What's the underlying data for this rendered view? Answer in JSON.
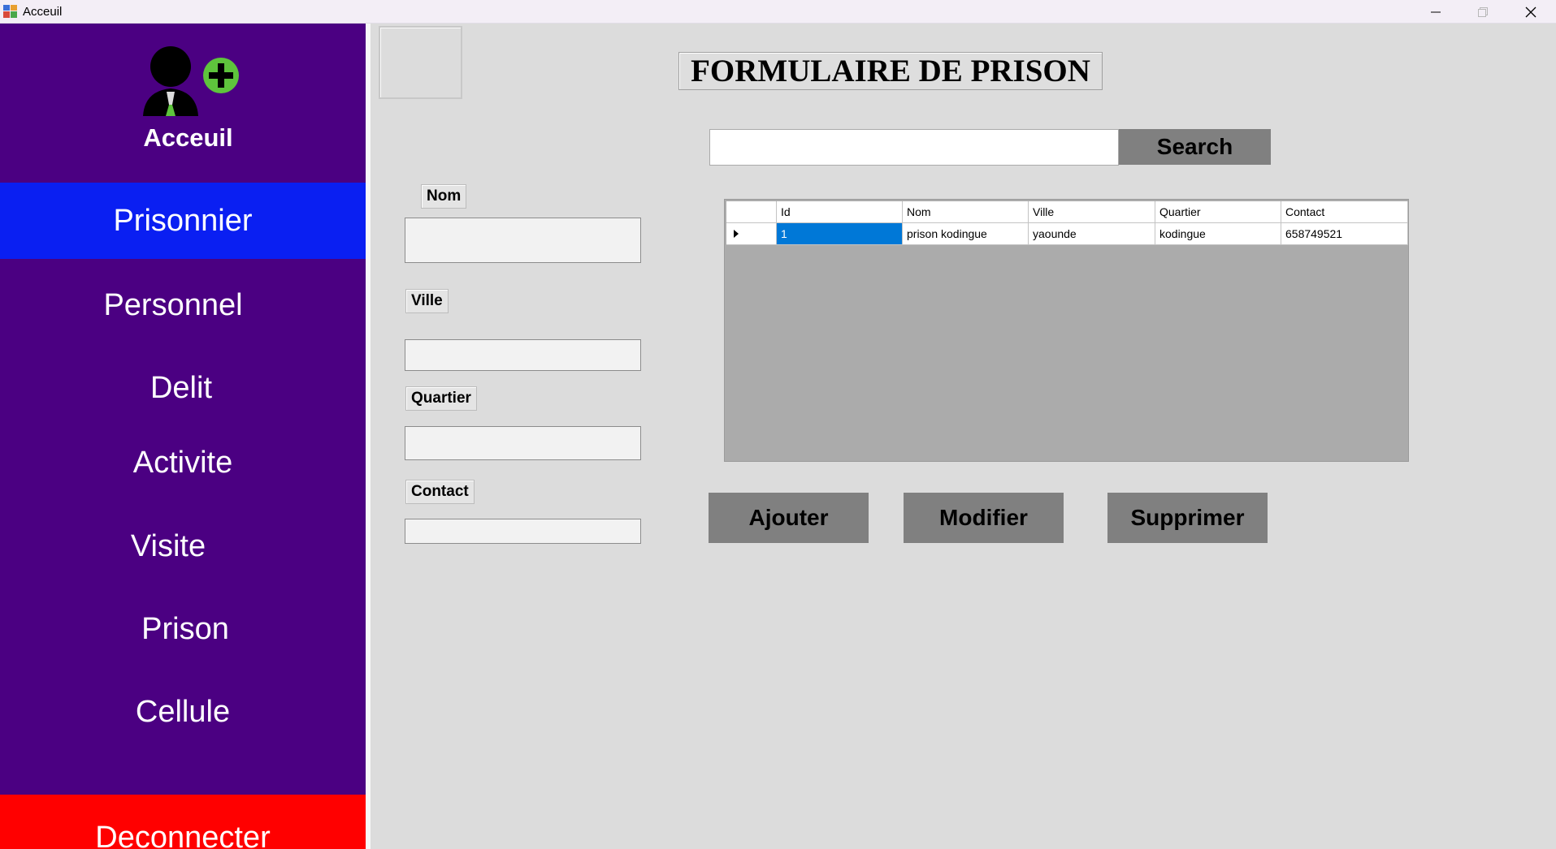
{
  "window": {
    "title": "Acceuil"
  },
  "sidebar": {
    "home_label": "Acceuil",
    "items": [
      {
        "label": "Prisonnier",
        "active": true
      },
      {
        "label": "Personnel",
        "active": false
      },
      {
        "label": "Delit",
        "active": false
      },
      {
        "label": "Activite",
        "active": false
      },
      {
        "label": "Visite",
        "active": false
      },
      {
        "label": "Prison",
        "active": false
      },
      {
        "label": "Cellule",
        "active": false
      }
    ],
    "logout_label": "Deconnecter",
    "colors": {
      "background": "#4b0082",
      "active": "#0a1ff2",
      "logout": "#ff0000"
    }
  },
  "main": {
    "title": "FORMULAIRE DE PRISON",
    "search": {
      "value": "",
      "button_label": "Search"
    },
    "form": {
      "nom_label": "Nom",
      "nom_value": "",
      "ville_label": "Ville",
      "ville_value": "",
      "quartier_label": "Quartier",
      "quartier_value": "",
      "contact_label": "Contact",
      "contact_value": ""
    },
    "grid": {
      "columns": [
        "Id",
        "Nom",
        "Ville",
        "Quartier",
        "Contact"
      ],
      "rows": [
        [
          "1",
          "prison kodingue",
          "yaounde",
          "kodingue",
          "658749521"
        ]
      ]
    },
    "actions": {
      "add_label": "Ajouter",
      "edit_label": "Modifier",
      "delete_label": "Supprimer"
    }
  }
}
